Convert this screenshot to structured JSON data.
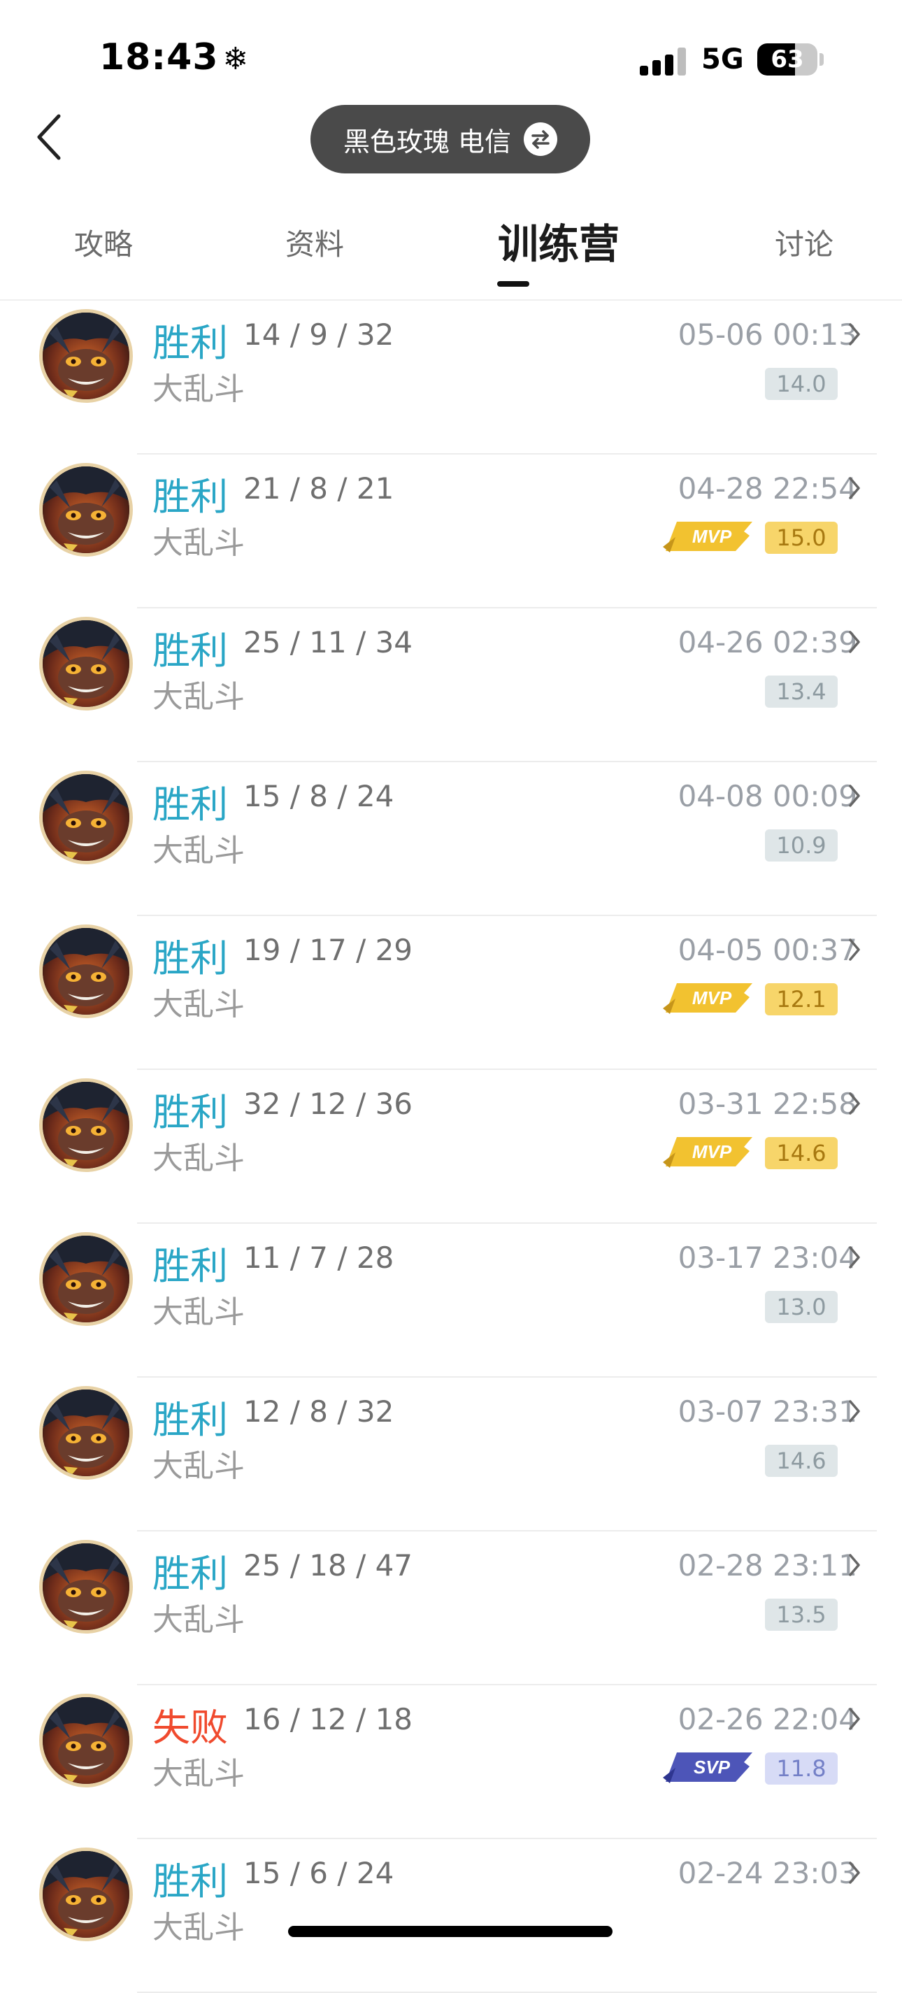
{
  "status_bar": {
    "time": "18:43",
    "network": "5G",
    "battery_percent": "63",
    "battery_level": 0.63
  },
  "header": {
    "account_label": "黑色玫瑰 电信"
  },
  "tabs": [
    {
      "label": "攻略",
      "active": false
    },
    {
      "label": "资料",
      "active": false
    },
    {
      "label": "训练营",
      "active": true
    },
    {
      "label": "讨论",
      "active": false
    }
  ],
  "matches": [
    {
      "result": "胜利",
      "outcome": "win",
      "kda": "14 / 9 / 32",
      "mode": "大乱斗",
      "datetime": "05-06 00:13",
      "score": "14.0",
      "honor": ""
    },
    {
      "result": "胜利",
      "outcome": "win",
      "kda": "21 / 8 / 21",
      "mode": "大乱斗",
      "datetime": "04-28 22:54",
      "score": "15.0",
      "honor": "MVP"
    },
    {
      "result": "胜利",
      "outcome": "win",
      "kda": "25 / 11 / 34",
      "mode": "大乱斗",
      "datetime": "04-26 02:39",
      "score": "13.4",
      "honor": ""
    },
    {
      "result": "胜利",
      "outcome": "win",
      "kda": "15 / 8 / 24",
      "mode": "大乱斗",
      "datetime": "04-08 00:09",
      "score": "10.9",
      "honor": ""
    },
    {
      "result": "胜利",
      "outcome": "win",
      "kda": "19 / 17 / 29",
      "mode": "大乱斗",
      "datetime": "04-05 00:37",
      "score": "12.1",
      "honor": "MVP"
    },
    {
      "result": "胜利",
      "outcome": "win",
      "kda": "32 / 12 / 36",
      "mode": "大乱斗",
      "datetime": "03-31 22:58",
      "score": "14.6",
      "honor": "MVP"
    },
    {
      "result": "胜利",
      "outcome": "win",
      "kda": "11 / 7 / 28",
      "mode": "大乱斗",
      "datetime": "03-17 23:04",
      "score": "13.0",
      "honor": ""
    },
    {
      "result": "胜利",
      "outcome": "win",
      "kda": "12 / 8 / 32",
      "mode": "大乱斗",
      "datetime": "03-07 23:31",
      "score": "14.6",
      "honor": ""
    },
    {
      "result": "胜利",
      "outcome": "win",
      "kda": "25 / 18 / 47",
      "mode": "大乱斗",
      "datetime": "02-28 23:11",
      "score": "13.5",
      "honor": ""
    },
    {
      "result": "失败",
      "outcome": "loss",
      "kda": "16 / 12 / 18",
      "mode": "大乱斗",
      "datetime": "02-26 22:04",
      "score": "11.8",
      "honor": "SVP"
    },
    {
      "result": "胜利",
      "outcome": "win",
      "kda": "15 / 6 / 24",
      "mode": "大乱斗",
      "datetime": "02-24 23:03",
      "score": "",
      "honor": ""
    }
  ],
  "colors": {
    "win": "#2aa6c6",
    "loss": "#f04a2e",
    "mvp": "#f2c230",
    "svp": "#4d55b8"
  },
  "icons": {
    "back": "chevron-left-icon",
    "swap": "swap-icon",
    "row_arrow": "chevron-right-icon"
  }
}
